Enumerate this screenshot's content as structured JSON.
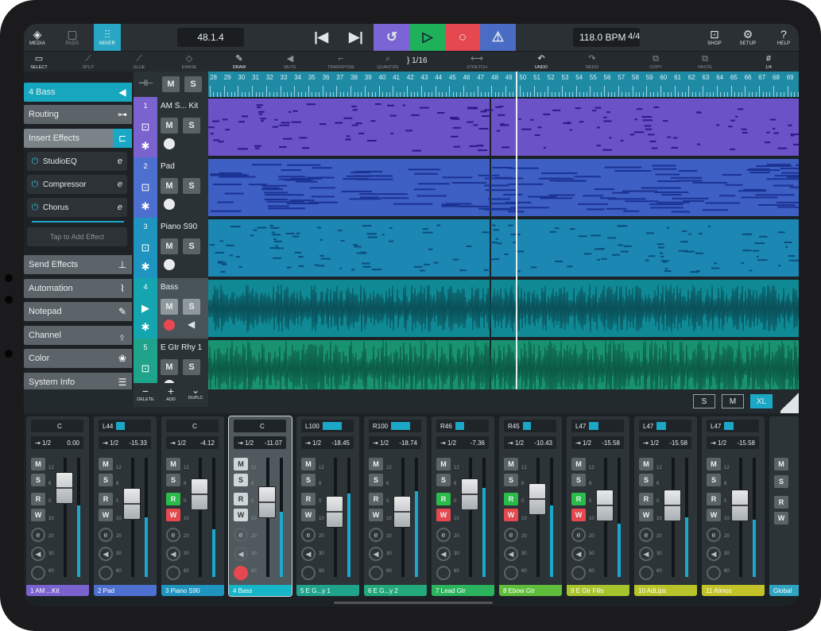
{
  "toolbar": {
    "media_label": "MEDIA",
    "pads_label": "PADS",
    "mixer_label": "MIXER",
    "position": "48.1.4",
    "tempo": "118.0 BPM",
    "signature": "4/4",
    "shop_label": "SHOP",
    "setup_label": "SETUP",
    "help_label": "HELP"
  },
  "tools": {
    "select": "SELECT",
    "split": "SPLIT",
    "glue": "GLUE",
    "erase": "ERASE",
    "draw": "DRAW",
    "mute": "MUTE",
    "transpose": "TRANSPOSE",
    "quantize": "QUANTIZE",
    "quantize_value": "1/16",
    "stretch": "STRETCH",
    "undo": "UNDO",
    "redo": "REDO",
    "copy": "COPY",
    "paste": "PASTE",
    "grid": "1/4"
  },
  "inspector": {
    "track": "4  Bass",
    "routing": "Routing",
    "insert_effects": "Insert Effects",
    "plugins": [
      "StudioEQ",
      "Compressor",
      "Chorus"
    ],
    "tap_to_add": "Tap to Add Effect",
    "send_effects": "Send Effects",
    "automation": "Automation",
    "notepad": "Notepad",
    "channel": "Channel",
    "color": "Color",
    "system_info": "System Info"
  },
  "tracks": [
    {
      "num": "1",
      "name": "AM S... Kit",
      "color": "#7a62cf"
    },
    {
      "num": "2",
      "name": "Pad",
      "color": "#4d6fd0"
    },
    {
      "num": "3",
      "name": "Piano S90",
      "color": "#1e94bf"
    },
    {
      "num": "4",
      "name": "Bass",
      "color": "#14a5b0"
    },
    {
      "num": "5",
      "name": "E Gtr Rhy 1",
      "color": "#1fa38a"
    }
  ],
  "header_buttons": {
    "mute": "M",
    "solo": "S",
    "delete": "DELETE",
    "add": "ADD",
    "duplicate": "DUPLC"
  },
  "ruler": [
    "28",
    "29",
    "30",
    "31",
    "32",
    "33",
    "34",
    "35",
    "36",
    "37",
    "38",
    "39",
    "40",
    "41",
    "42",
    "43",
    "44",
    "45",
    "46",
    "47",
    "48",
    "49",
    "50",
    "51",
    "52",
    "53",
    "54",
    "55",
    "56",
    "57",
    "58",
    "59",
    "60",
    "61",
    "62",
    "63",
    "64",
    "65",
    "66",
    "67",
    "68",
    "69"
  ],
  "mixer": {
    "sizes": [
      "S",
      "M",
      "XL"
    ],
    "strips": [
      {
        "pan": "C",
        "send": "1/2",
        "vol": "0.00",
        "name": "1   AM ...Kit",
        "color": "#7a62cf",
        "rw": false
      },
      {
        "pan": "L44",
        "send": "1/2",
        "vol": "-15.33",
        "name": "2   Pad",
        "color": "#4d6fd0",
        "rw": false
      },
      {
        "pan": "C",
        "send": "1/2",
        "vol": "-4.12",
        "name": "3   Piano S90",
        "color": "#1e94bf",
        "rw": true
      },
      {
        "pan": "C",
        "send": "1/2",
        "vol": "-11.07",
        "name": "4   Bass",
        "color": "#14a5b0",
        "rw": false
      },
      {
        "pan": "L100",
        "send": "1/2",
        "vol": "-18.45",
        "name": "5   E G...y 1",
        "color": "#1fa38a",
        "rw": false
      },
      {
        "pan": "R100",
        "send": "1/2",
        "vol": "-18.74",
        "name": "6   E G...y 2",
        "color": "#22a87a",
        "rw": false
      },
      {
        "pan": "R46",
        "send": "1/2",
        "vol": "-7.36",
        "name": "7   Lead Gtr",
        "color": "#2bb35e",
        "rw": true
      },
      {
        "pan": "R45",
        "send": "1/2",
        "vol": "-10.43",
        "name": "8   Ebow Gtr",
        "color": "#5fbd3c",
        "rw": true
      },
      {
        "pan": "L47",
        "send": "1/2",
        "vol": "-15.58",
        "name": "9   E Gtr Fills",
        "color": "#a7c42c",
        "rw": true
      },
      {
        "pan": "L47",
        "send": "1/2",
        "vol": "-15.58",
        "name": "10  AdLips",
        "color": "#b9c42a",
        "rw": false
      },
      {
        "pan": "L47",
        "send": "1/2",
        "vol": "-15.58",
        "name": "11  Atmos",
        "color": "#c3c228",
        "rw": false
      },
      {
        "pan": "",
        "send": "",
        "vol": "",
        "name": "Global",
        "color": "#2fa4c0",
        "rw": false
      }
    ]
  }
}
